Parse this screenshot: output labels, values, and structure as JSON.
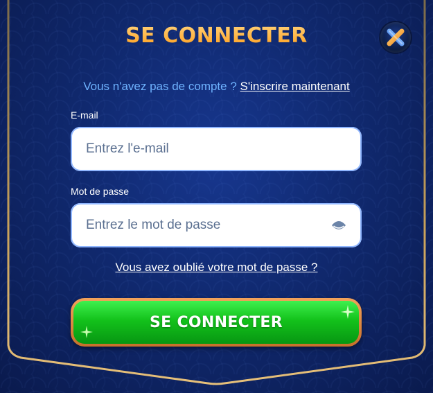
{
  "dialog": {
    "title": "SE CONNECTER",
    "close_icon": "close-x-icon"
  },
  "signup": {
    "prompt": "Vous n'avez pas de compte ?",
    "link": "S'inscrire maintenant"
  },
  "email": {
    "label": "E-mail",
    "placeholder": "Entrez l'e-mail",
    "value": ""
  },
  "password": {
    "label": "Mot de passe",
    "placeholder": "Entrez le mot de passe",
    "value": "",
    "toggle_icon": "eye-icon"
  },
  "forgot": {
    "label": "Vous avez oublié votre mot de passe ?"
  },
  "submit": {
    "label": "SE CONNECTER"
  },
  "colors": {
    "title": "#ffa72e",
    "link_blue": "#6fb3ff",
    "button_green": "#13c21b",
    "button_border": "#e0893f",
    "frame_gold": "#c9a25a",
    "background": "#10296f"
  }
}
